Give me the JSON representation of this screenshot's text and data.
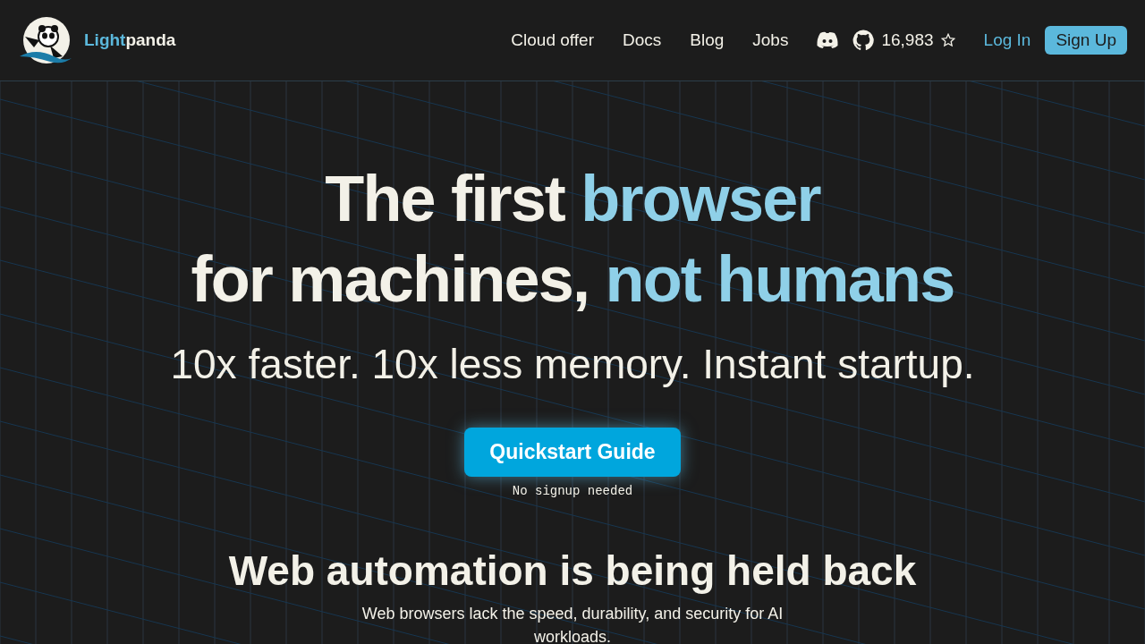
{
  "header": {
    "logo": {
      "accent": "Light",
      "text": "panda"
    },
    "nav": [
      "Cloud offer",
      "Docs",
      "Blog",
      "Jobs"
    ],
    "github_stars": "16,983",
    "login": "Log In",
    "signup": "Sign Up"
  },
  "hero": {
    "title_lines": [
      {
        "text": "The first ",
        "accent": "browser"
      },
      {
        "text": "for machines, ",
        "accent": "not humans"
      }
    ],
    "subtitle": "10x faster. 10x less memory. Instant startup.",
    "cta": "Quickstart Guide",
    "cta_note": "No signup needed"
  },
  "section": {
    "title": "Web automation is being held back",
    "text": "Web browsers lack the speed, durability, and security for AI workloads."
  }
}
